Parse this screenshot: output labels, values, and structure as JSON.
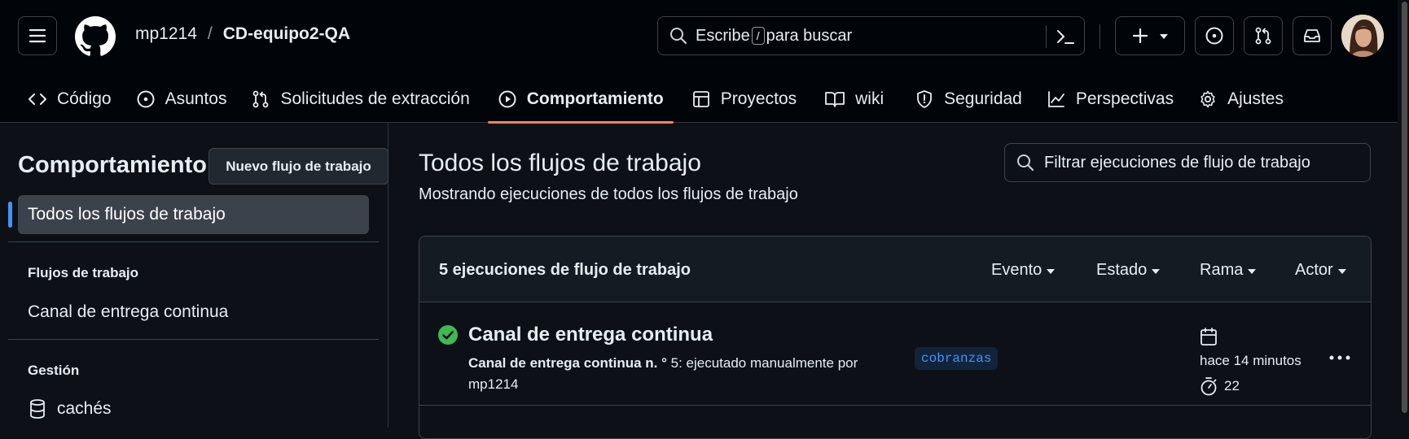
{
  "header": {
    "owner": "mp1214",
    "separator": "/",
    "repo": "CD-equipo2-QA",
    "search": {
      "prefix": "Escribe",
      "key": "/",
      "suffix": "para buscar"
    }
  },
  "tabs": [
    {
      "label": "Código",
      "icon": "code-icon"
    },
    {
      "label": "Asuntos",
      "icon": "issue-opened-icon"
    },
    {
      "label": "Solicitudes de extracción",
      "icon": "git-pull-request-icon"
    },
    {
      "label": "Comportamiento",
      "icon": "play-icon",
      "selected": true
    },
    {
      "label": "Proyectos",
      "icon": "table-icon"
    },
    {
      "label": "wiki",
      "icon": "book-icon"
    },
    {
      "label": "Seguridad",
      "icon": "shield-icon"
    },
    {
      "label": "Perspectivas",
      "icon": "graph-icon"
    },
    {
      "label": "Ajustes",
      "icon": "gear-icon"
    }
  ],
  "sidebar": {
    "title": "Comportamiento",
    "new_workflow_button": "Nuevo flujo de trabajo",
    "all_workflows": "Todos los flujos de trabajo",
    "workflows_heading": "Flujos de trabajo",
    "workflows": [
      "Canal de entrega continua"
    ],
    "management_heading": "Gestión",
    "caches": "cachés"
  },
  "main": {
    "title": "Todos los flujos de trabajo",
    "subtitle": "Mostrando ejecuciones de todos los flujos de trabajo",
    "filter_placeholder": "Filtrar ejecuciones de flujo de trabajo",
    "runs_count": "5 ejecuciones de flujo de trabajo",
    "filters": [
      "Evento",
      "Estado",
      "Rama",
      "Actor"
    ],
    "runs": [
      {
        "title": "Canal de entrega continua",
        "desc_bold": "Canal de entrega continua n. °",
        "desc_rest": " 5: ejecutado manualmente por mp1214",
        "branch": "cobranzas",
        "time": "hace 14 minutos",
        "duration": "22",
        "status": "success"
      }
    ]
  },
  "colors": {
    "background": "#0d1117",
    "header_bg": "#010409",
    "accent_underline": "#f78166",
    "success": "#3fb950",
    "link_blue": "#4493f8"
  }
}
